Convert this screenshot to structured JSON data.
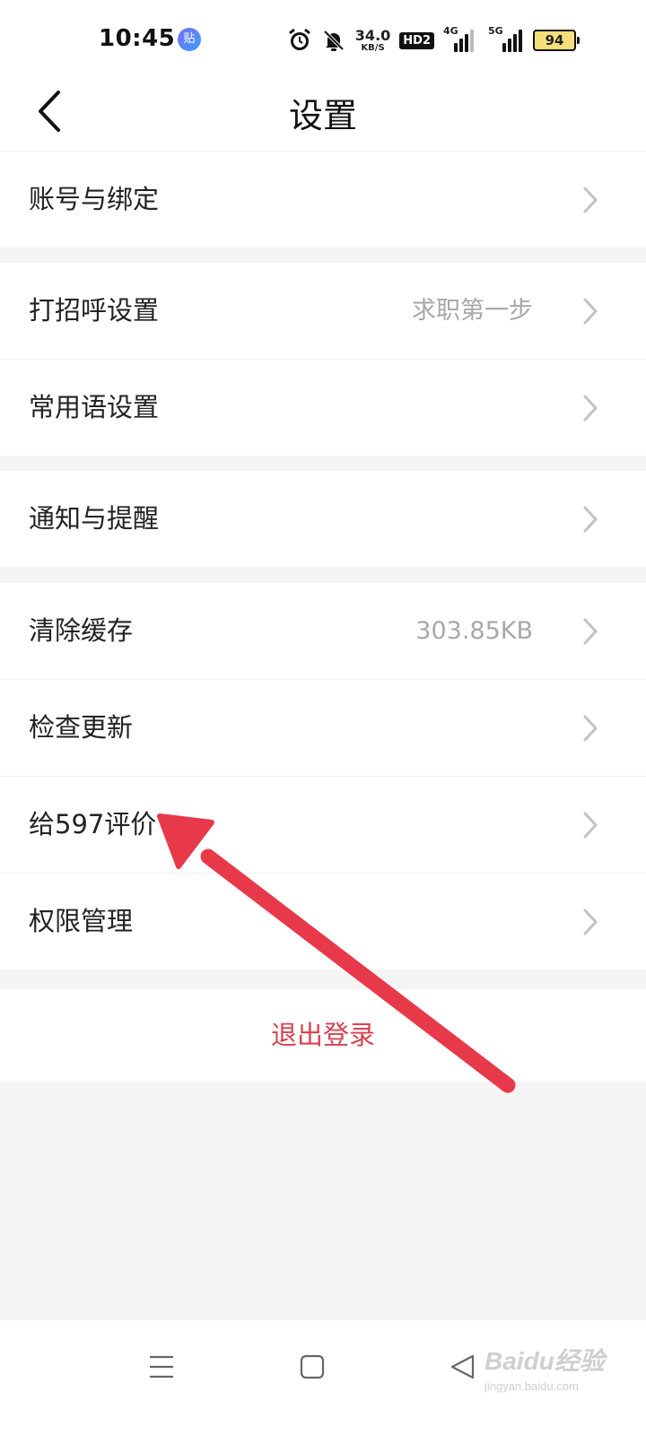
{
  "status_bar": {
    "time": "10:45",
    "app_badge": "贴",
    "net_speed_value": "34.0",
    "net_speed_unit": "KB/S",
    "hd_label": "HD2",
    "net1_label": "4G",
    "net2_label": "5G",
    "battery": "94"
  },
  "navbar": {
    "title": "设置"
  },
  "sections": [
    {
      "items": [
        {
          "label": "账号与绑定",
          "value": ""
        }
      ]
    },
    {
      "items": [
        {
          "label": "打招呼设置",
          "value": "求职第一步"
        },
        {
          "label": "常用语设置",
          "value": ""
        }
      ]
    },
    {
      "items": [
        {
          "label": "通知与提醒",
          "value": ""
        }
      ]
    },
    {
      "items": [
        {
          "label": "清除缓存",
          "value": "303.85KB"
        },
        {
          "label": "检查更新",
          "value": ""
        },
        {
          "label": "给597评价",
          "value": ""
        },
        {
          "label": "权限管理",
          "value": ""
        }
      ]
    }
  ],
  "logout_label": "退出登录",
  "watermark": {
    "top": "Baidu经验",
    "bottom": "jingyan.baidu.com"
  },
  "colors": {
    "accent_red": "#d9414f",
    "arrow_red": "#e8394a",
    "page_bg": "#f4f4f4"
  }
}
